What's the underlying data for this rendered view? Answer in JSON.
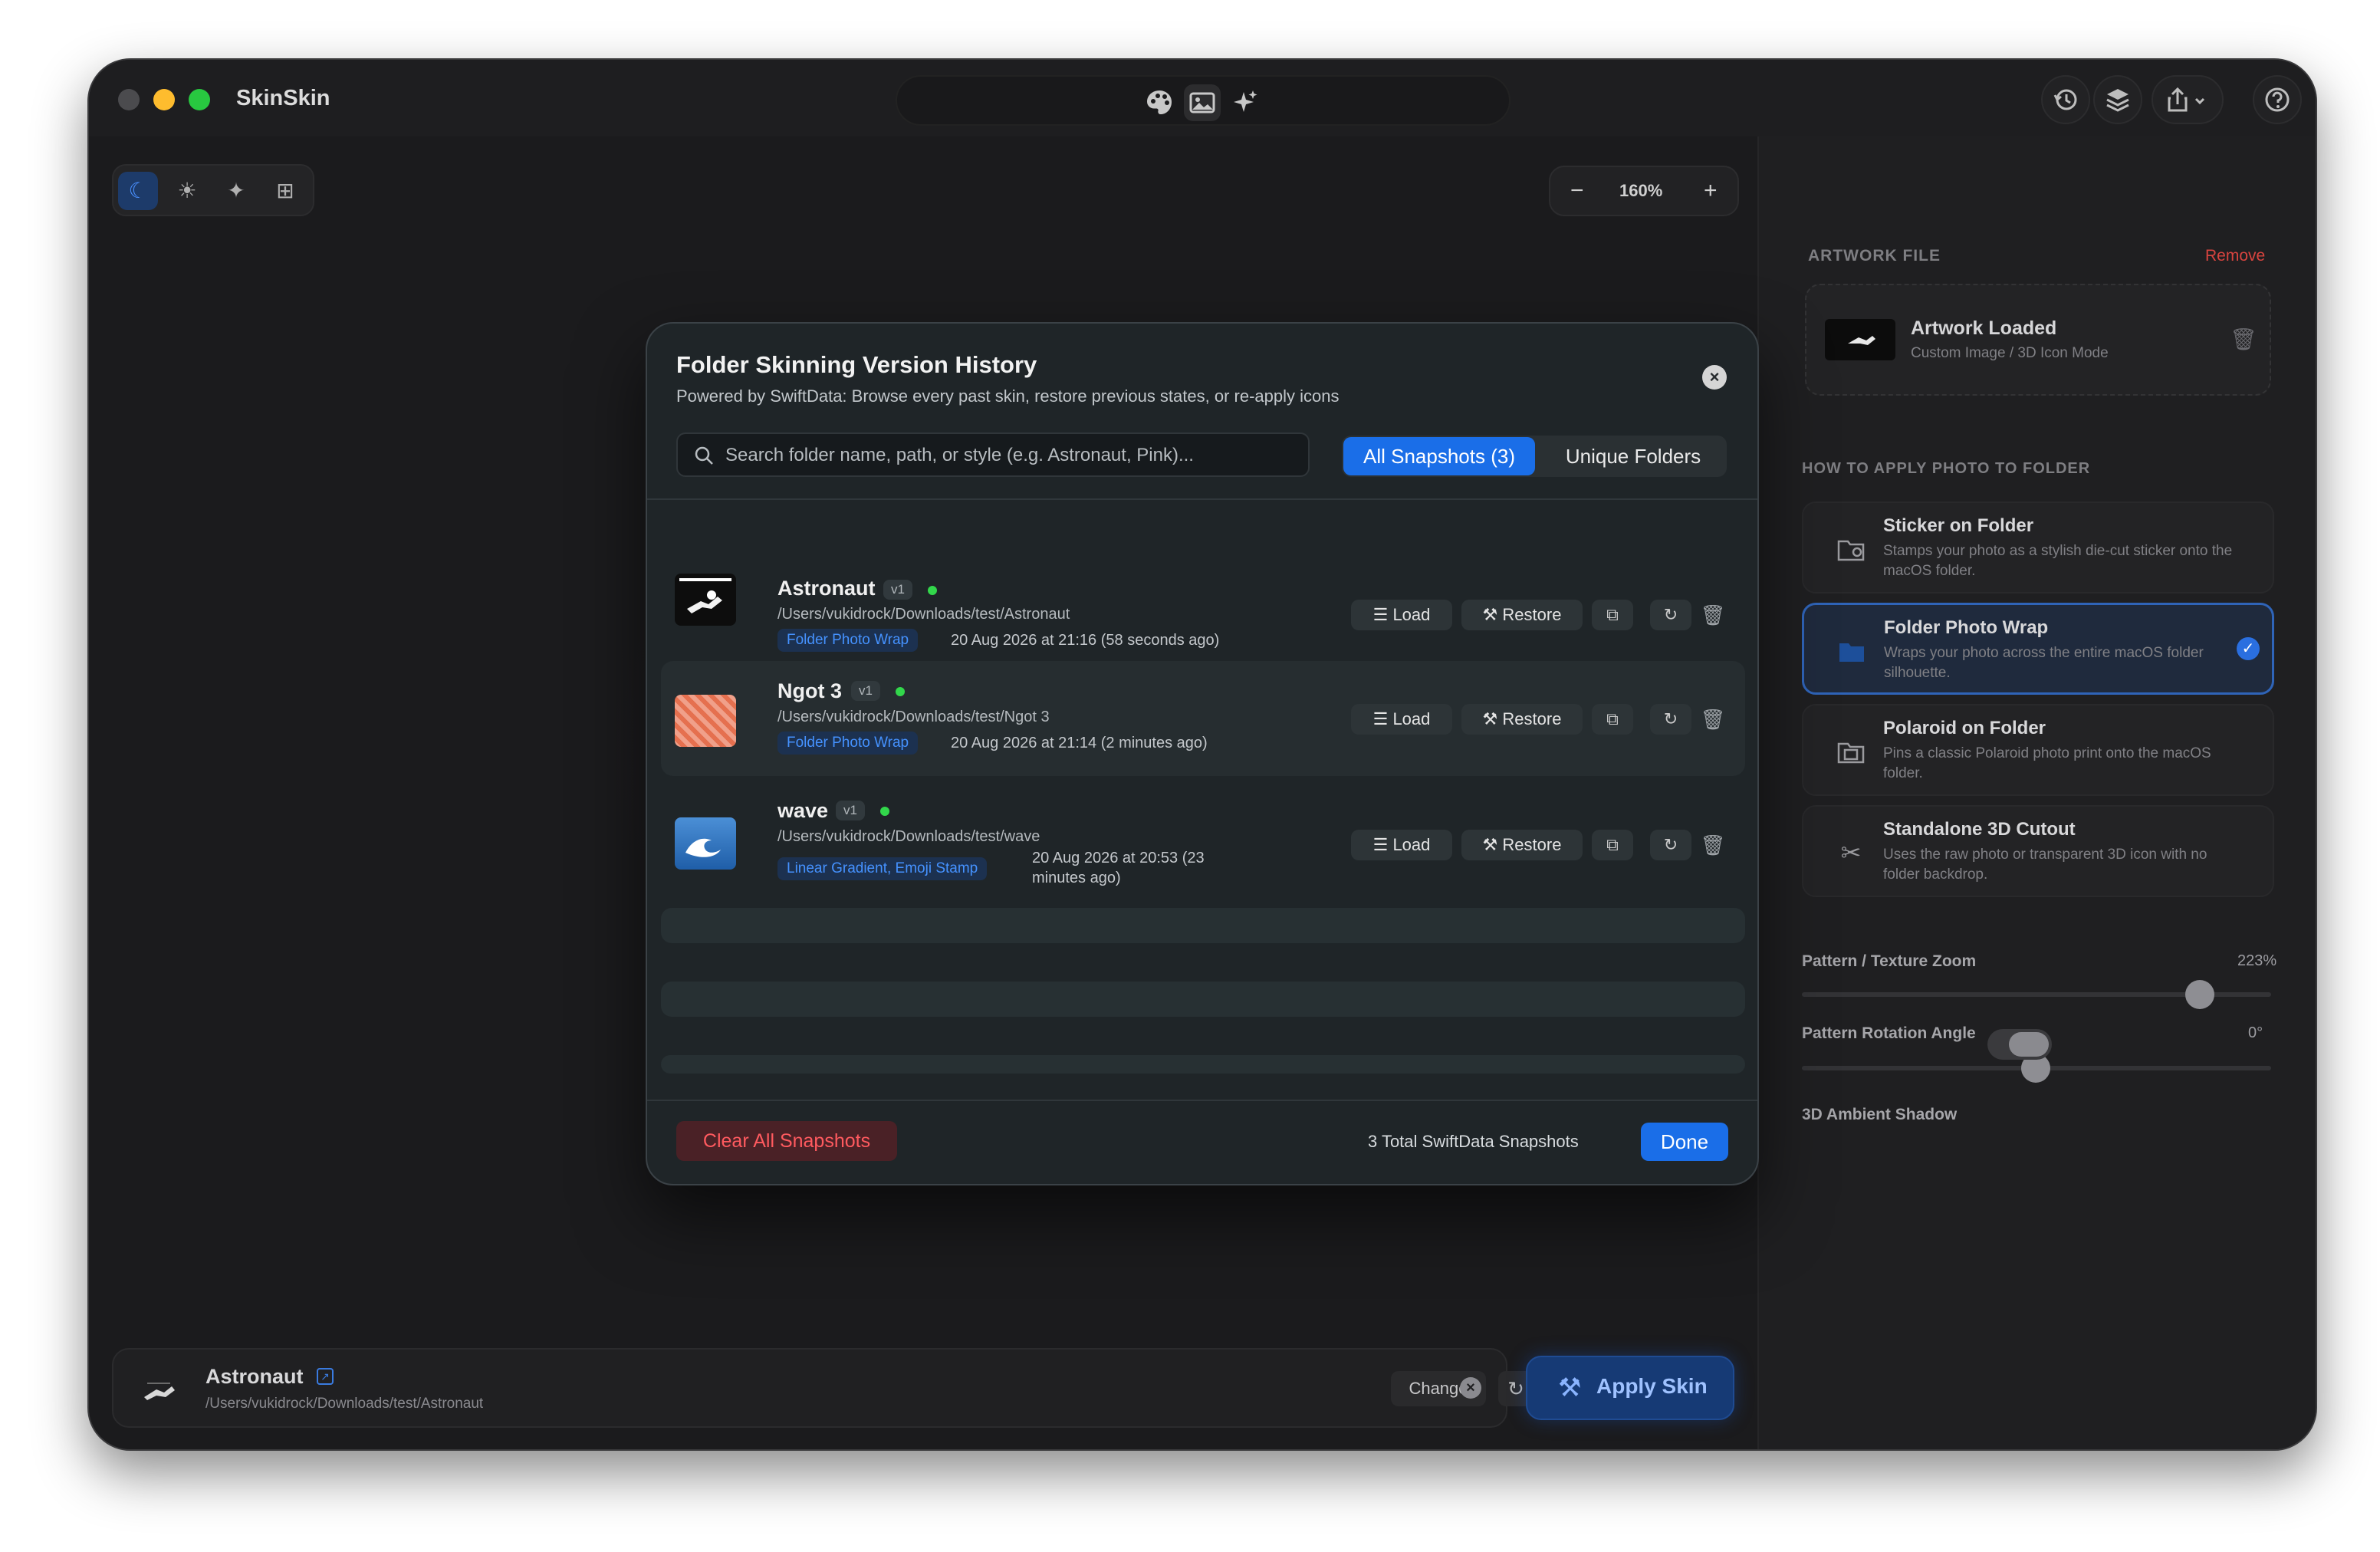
{
  "app": {
    "title": "SkinSkin"
  },
  "toolbar": {
    "palette_icon": "palette-icon",
    "image_icon": "image-icon",
    "sparkle_icon": "sparkle-icon"
  },
  "zoom": {
    "minus": "−",
    "value": "160%",
    "plus": "+"
  },
  "right_panel": {
    "artwork_label": "ARTWORK FILE",
    "remove_label": "Remove",
    "artwork_title": "Artwork Loaded",
    "artwork_sub": "Custom Image / 3D Icon Mode",
    "how_label": "HOW TO APPLY PHOTO TO FOLDER",
    "options": [
      {
        "title": "Sticker on Folder",
        "desc": "Stamps your photo as a stylish die-cut sticker onto the macOS folder.",
        "selected": false
      },
      {
        "title": "Folder Photo Wrap",
        "desc": "Wraps your photo across the entire macOS folder silhouette.",
        "selected": true
      },
      {
        "title": "Polaroid on Folder",
        "desc": "Pins a classic Polaroid photo print onto the macOS folder.",
        "selected": false
      },
      {
        "title": "Standalone 3D Cutout",
        "desc": "Uses the raw photo or transparent 3D icon with no folder backdrop.",
        "selected": false
      }
    ],
    "zoom_label": "Pattern / Texture Zoom",
    "zoom_value": "223%",
    "zoom_level": 0.85,
    "rotation_label": "Pattern Rotation Angle",
    "rotation_value": "0°",
    "rotation_level": 0.5,
    "shadow_label": "3D Ambient Shadow",
    "shadow_on": false
  },
  "bottom_bar": {
    "name": "Astronaut",
    "path": "/Users/vukidrock/Downloads/test/Astronaut",
    "change_label": "Change",
    "apply_label": "Apply Skin"
  },
  "modal": {
    "title": "Folder Skinning Version History",
    "subtitle": "Powered by SwiftData: Browse every past skin, restore previous states, or re-apply icons",
    "search_placeholder": "Search folder name, path, or style (e.g. Astronaut, Pink)...",
    "tab_all": "All Snapshots (3)",
    "tab_unique": "Unique Folders",
    "load_label": "Load",
    "restore_label": "Restore",
    "rows": [
      {
        "name": "Astronaut",
        "version": "v1",
        "path": "/Users/vukidrock/Downloads/test/Astronaut",
        "style": "Folder Photo Wrap",
        "date": "20 Aug 2026 at 21:16 (58 seconds ago)"
      },
      {
        "name": "Ngot 3",
        "version": "v1",
        "path": "/Users/vukidrock/Downloads/test/Ngot 3",
        "style": "Folder Photo Wrap",
        "date": "20 Aug 2026 at 21:14 (2 minutes ago)"
      },
      {
        "name": "wave",
        "version": "v1",
        "path": "/Users/vukidrock/Downloads/test/wave",
        "style": "Linear Gradient, Emoji Stamp",
        "date_line1": "20 Aug 2026 at 20:53 (23",
        "date_line2": "minutes ago)"
      }
    ],
    "clear_label": "Clear All Snapshots",
    "total_label": "3 Total SwiftData Snapshots",
    "done_label": "Done"
  }
}
